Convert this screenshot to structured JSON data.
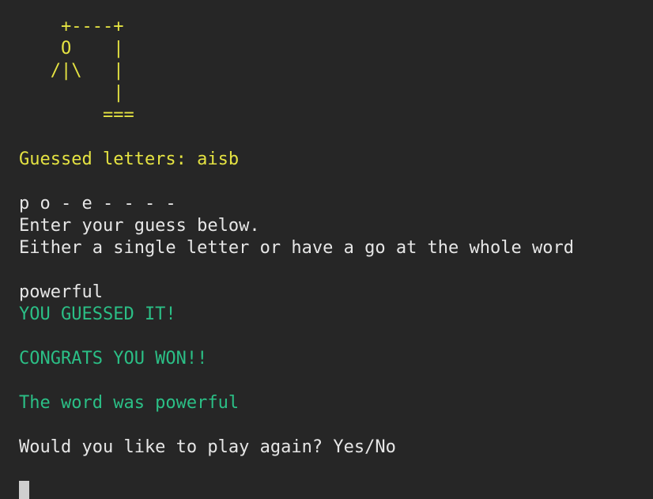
{
  "hangman_art": [
    "    +----+",
    "    O    |",
    "   /|\\   |",
    "         |",
    "        ==="
  ],
  "guessed_letters": "Guessed letters: aisb",
  "word_progress": "p o - e - - - -",
  "prompt_1": "Enter your guess below.",
  "prompt_2": "Either a single letter or have a go at the whole word",
  "user_input": "powerful",
  "result_message": "YOU GUESSED IT!",
  "win_message": "CONGRATS YOU WON!!",
  "word_reveal": "The word was powerful",
  "play_again_prompt": "Would you like to play again? Yes/No",
  "colors": {
    "background": "#262626",
    "yellow": "#e5e342",
    "green": "#2bbf86",
    "text": "#e6e6e6"
  }
}
